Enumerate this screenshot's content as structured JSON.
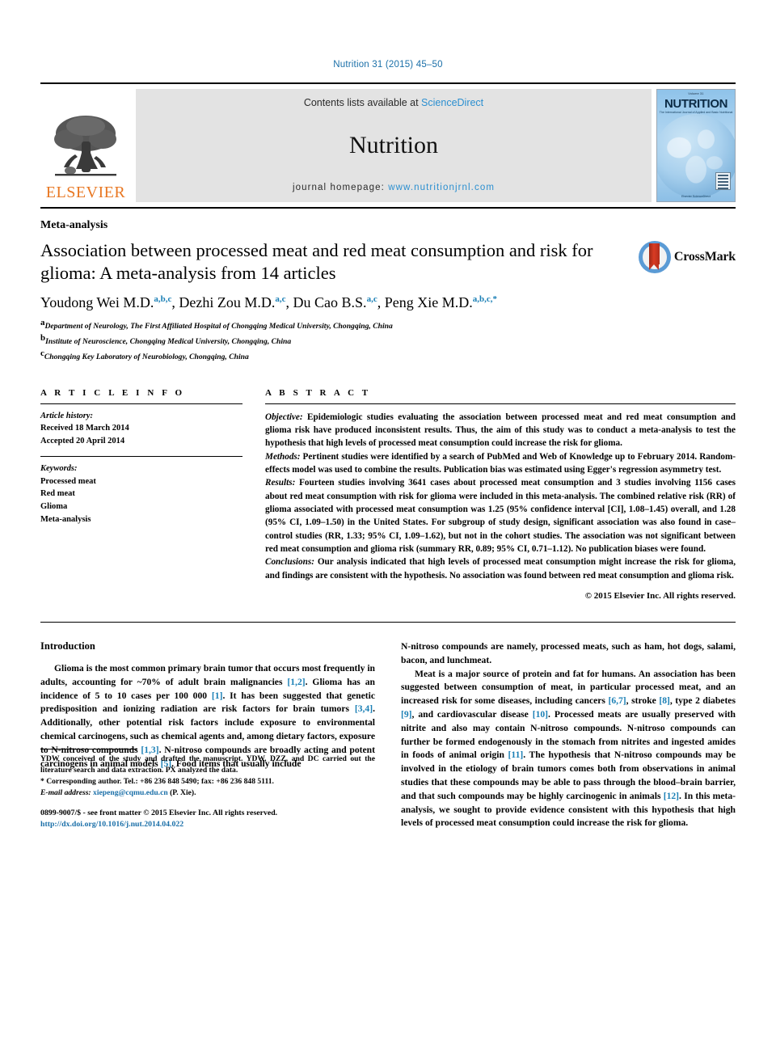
{
  "running_head": "Nutrition 31 (2015) 45–50",
  "header": {
    "elsevier_wordmark": "ELSEVIER",
    "contents_prefix": "Contents lists available at ",
    "contents_link": "ScienceDirect",
    "journal_title": "Nutrition",
    "homepage_label": "journal homepage: ",
    "homepage_url": "www.nutritionjrnl.com",
    "cover": {
      "volume_line": "Volume 31",
      "masthead": "NUTRITION",
      "subtitle": "The International Journal of Applied and Basic Nutritional Sciences",
      "footer": "Elsevier ScienceDirect"
    },
    "colors": {
      "link": "#2b8fd0",
      "elsevier_orange": "#E87722",
      "band_gray": "#e3e3e3"
    }
  },
  "article": {
    "type": "Meta-analysis",
    "title": "Association between processed meat and red meat consumption and risk for glioma: A meta-analysis from 14 articles",
    "crossmark_label": "CrossMark",
    "authors": [
      {
        "name": "Youdong Wei M.D.",
        "marks": "a,b,c",
        "sep": ", "
      },
      {
        "name": "Dezhi Zou M.D.",
        "marks": "a,c",
        "sep": ", "
      },
      {
        "name": "Du Cao B.S.",
        "marks": "a,c",
        "sep": ", "
      },
      {
        "name": "Peng Xie M.D.",
        "marks": "a,b,c,*",
        "sep": ""
      }
    ],
    "affiliations": [
      {
        "mark": "a",
        "text": "Department of Neurology, The First Affiliated Hospital of Chongqing Medical University, Chongqing, China"
      },
      {
        "mark": "b",
        "text": "Institute of Neuroscience, Chongqing Medical University, Chongqing, China"
      },
      {
        "mark": "c",
        "text": "Chongqing Key Laboratory of Neurobiology, Chongqing, China"
      }
    ]
  },
  "article_info": {
    "heading": "A R T I C L E    I N F O",
    "history_label": "Article history:",
    "received": "Received 18 March 2014",
    "accepted": "Accepted 20 April 2014",
    "keywords_label": "Keywords:",
    "keywords": [
      "Processed meat",
      "Red meat",
      "Glioma",
      "Meta-analysis"
    ]
  },
  "abstract": {
    "heading": "A B S T R A C T",
    "sections": [
      {
        "label": "Objective:",
        "text": " Epidemiologic studies evaluating the association between processed meat and red meat consumption and glioma risk have produced inconsistent results. Thus, the aim of this study was to conduct a meta-analysis to test the hypothesis that high levels of processed meat consumption could increase the risk for glioma."
      },
      {
        "label": "Methods:",
        "text": " Pertinent studies were identified by a search of PubMed and Web of Knowledge up to February 2014. Random-effects model was used to combine the results. Publication bias was estimated using Egger's regression asymmetry test."
      },
      {
        "label": "Results:",
        "text": " Fourteen studies involving 3641 cases about processed meat consumption and 3 studies involving 1156 cases about red meat consumption with risk for glioma were included in this meta-analysis. The combined relative risk (RR) of glioma associated with processed meat consumption was 1.25 (95% confidence interval [CI], 1.08–1.45) overall, and 1.28 (95% CI, 1.09–1.50) in the United States. For subgroup of study design, significant association was also found in case–control studies (RR, 1.33; 95% CI, 1.09–1.62), but not in the cohort studies. The association was not significant between red meat consumption and glioma risk (summary RR, 0.89; 95% CI, 0.71–1.12). No publication biases were found."
      },
      {
        "label": "Conclusions:",
        "text": " Our analysis indicated that high levels of processed meat consumption might increase the risk for glioma, and findings are consistent with the hypothesis. No association was found between red meat consumption and glioma risk."
      }
    ],
    "copyright": "© 2015 Elsevier Inc. All rights reserved."
  },
  "body": {
    "intro_heading": "Introduction",
    "left_paragraphs": [
      {
        "runs": [
          {
            "t": "Glioma is the most common primary brain tumor that occurs most frequently in adults, accounting for ~70% of adult brain malignancies "
          },
          {
            "t": "[1,2]",
            "ref": true
          },
          {
            "t": ". Glioma has an incidence of 5 to 10 cases per 100 000 "
          },
          {
            "t": "[1]",
            "ref": true
          },
          {
            "t": ". It has been suggested that genetic predisposition and ionizing radiation are risk factors for brain tumors "
          },
          {
            "t": "[3,4]",
            "ref": true
          },
          {
            "t": ". Additionally, other potential risk factors include exposure to environmental chemical carcinogens, such as chemical agents and, among dietary factors, exposure to N-nitroso compounds "
          },
          {
            "t": "[1,3]",
            "ref": true
          },
          {
            "t": ". N-nitroso compounds are broadly acting and potent carcinogens in animal models "
          },
          {
            "t": "[5]",
            "ref": true
          },
          {
            "t": ". Food items that usually include"
          }
        ]
      }
    ],
    "right_paragraphs": [
      {
        "indent": false,
        "runs": [
          {
            "t": "N-nitroso compounds are namely, processed meats, such as ham, hot dogs, salami, bacon, and lunchmeat."
          }
        ]
      },
      {
        "indent": true,
        "runs": [
          {
            "t": "Meat is a major source of protein and fat for humans. An association has been suggested between consumption of meat, in particular processed meat, and an increased risk for some diseases, including cancers "
          },
          {
            "t": "[6,7]",
            "ref": true
          },
          {
            "t": ", stroke "
          },
          {
            "t": "[8]",
            "ref": true
          },
          {
            "t": ", type 2 diabetes "
          },
          {
            "t": "[9]",
            "ref": true
          },
          {
            "t": ", and cardiovascular disease "
          },
          {
            "t": "[10]",
            "ref": true
          },
          {
            "t": ". Processed meats are usually preserved with nitrite and also may contain N-nitroso compounds. N-nitroso compounds can further be formed endogenously in the stomach from nitrites and ingested amides in foods of animal origin "
          },
          {
            "t": "[11]",
            "ref": true
          },
          {
            "t": ". The hypothesis that N-nitroso compounds may be involved in the etiology of brain tumors comes both from observations in animal studies that these compounds may be able to pass through the blood–brain barrier, and that such compounds may be highly carcinogenic in animals "
          },
          {
            "t": "[12]",
            "ref": true
          },
          {
            "t": ". In this meta-analysis, we sought to provide evidence consistent with this hypothesis that high levels of processed meat consumption could increase the risk for glioma."
          }
        ]
      }
    ]
  },
  "footnotes": {
    "contributions": "YDW conceived of the study and drafted the manuscript. YDW, DZZ, and DC carried out the literature search and data extraction. PX analyzed the data.",
    "corresponding": "* Corresponding author. Tel.: +86 236 848 5490; fax: +86 236 848 5111.",
    "email_label": "E-mail address:",
    "email": "xiepeng@cqmu.edu.cn",
    "email_suffix": " (P. Xie).",
    "issn_line": "0899-9007/$ - see front matter © 2015 Elsevier Inc. All rights reserved.",
    "doi": "http://dx.doi.org/10.1016/j.nut.2014.04.022"
  }
}
